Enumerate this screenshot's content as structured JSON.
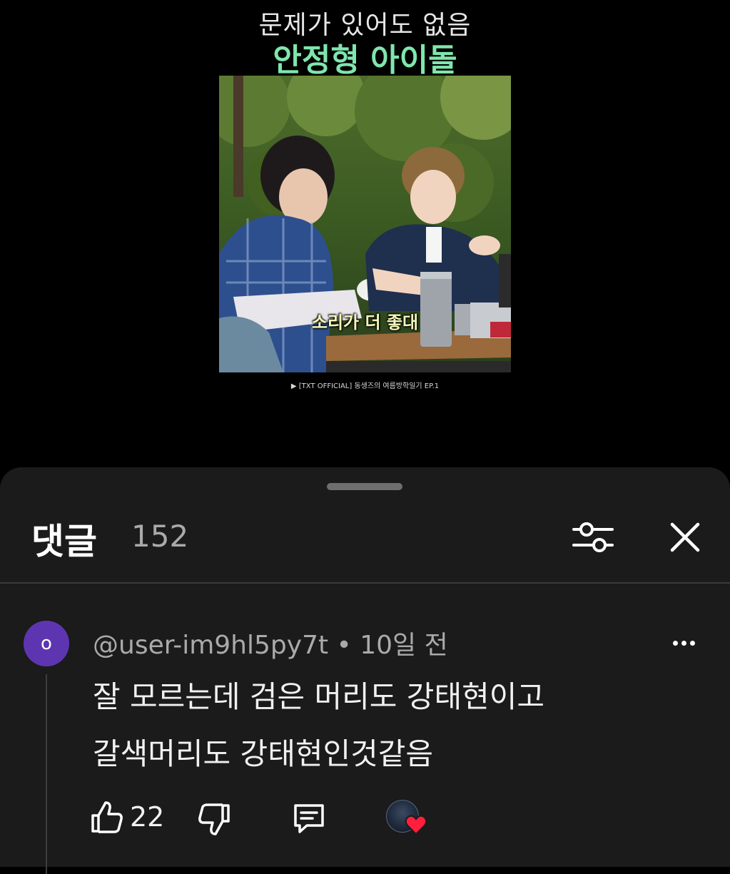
{
  "video": {
    "overlay_line1": "문제가 있어도 없음",
    "overlay_line2": "안정형 아이돌",
    "subtitle": "소리가 더 좋대",
    "source_caption": "▶ [TXT OFFICIAL] 동생즈의 여름방학일기 EP.1"
  },
  "comments_panel": {
    "title": "댓글",
    "count": "152"
  },
  "comment": {
    "avatar_initial": "o",
    "handle": "@user-im9hl5py7t",
    "separator": "•",
    "time": "10일 전",
    "text_line1": "잘 모르는데 검은 머리도 강태현이고",
    "text_line2": "갈색머리도 강태현인것같음",
    "like_count": "22"
  },
  "icons": {
    "filter": "sliders-icon",
    "close": "close-icon",
    "more": "more-vert-icon",
    "like": "thumb-up-icon",
    "dislike": "thumb-down-icon",
    "reply": "comment-icon",
    "creator_heart": "creator-heart-icon"
  },
  "colors": {
    "background": "#000000",
    "sheet": "#1b1b1b",
    "overlay_highlight": "#7fe6ad",
    "avatar": "#5e35b1",
    "heart": "#ff1e3c"
  }
}
